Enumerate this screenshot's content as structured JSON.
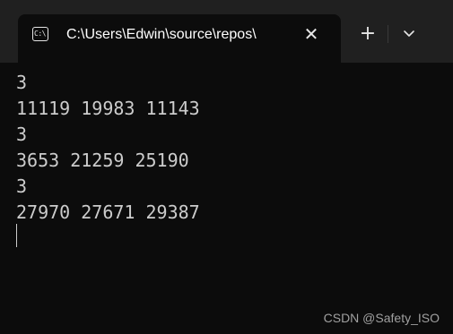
{
  "tab": {
    "title": "C:\\Users\\Edwin\\source\\repos\\",
    "icon": "terminal-icon",
    "close_glyph": "✕"
  },
  "toolbar": {
    "new_tab_glyph": "+",
    "dropdown_icon": "chevron-down-icon"
  },
  "terminal": {
    "lines": [
      "3",
      "11119 19983 11143",
      "3",
      "3653 21259 25190",
      "3",
      "27970 27671 29387"
    ]
  },
  "watermark": "CSDN @Safety_ISO",
  "colors": {
    "background": "#0c0c0c",
    "tabbar": "#202020",
    "text": "#cccccc"
  }
}
